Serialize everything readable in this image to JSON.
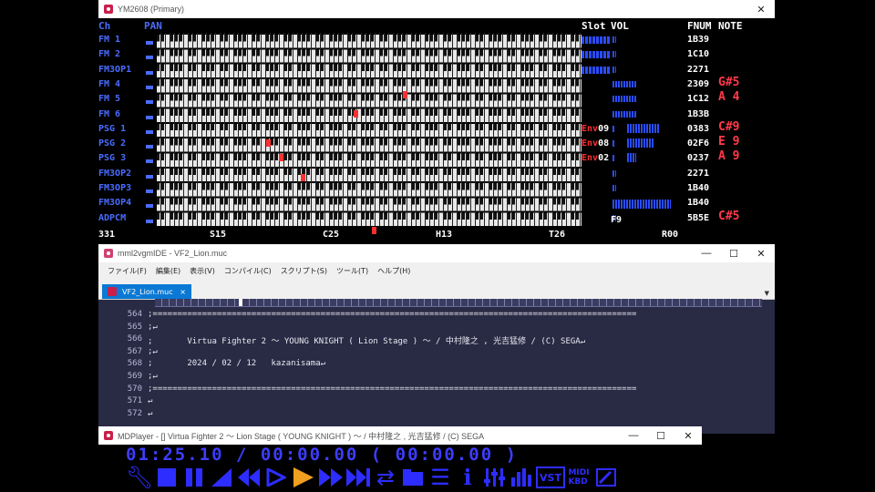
{
  "ym": {
    "title": "YM2608 (Primary)",
    "hdr_ch": "Ch",
    "hdr_pan": "PAN",
    "hdr_slot": "Slot",
    "hdr_vol": "VOL",
    "hdr_fnum": "FNUM",
    "hdr_note": "NOTE",
    "channels": [
      "FM 1",
      "FM 2",
      "FM3OP1",
      "FM 4",
      "FM 5",
      "FM 6",
      "PSG 1",
      "PSG 2",
      "PSG 3",
      "FM3OP2",
      "FM3OP3",
      "FM3OP4",
      "ADPCM"
    ],
    "fnums": [
      "1B39",
      "1C10",
      "2271",
      "2309",
      "1C12",
      "1B3B",
      "0383",
      "02F6",
      "0237",
      "2271",
      "1B40",
      "1B40",
      "5B5E"
    ],
    "notes": [
      {
        "row": 3,
        "text": "G#5"
      },
      {
        "row": 4,
        "text": "A 4"
      },
      {
        "row": 6,
        "text": "C#9"
      },
      {
        "row": 7,
        "text": "E 9"
      },
      {
        "row": 8,
        "text": "A 9"
      },
      {
        "row": 12,
        "text": "C#5"
      }
    ],
    "env": [
      {
        "row": 6,
        "label": "Env",
        "val": "09"
      },
      {
        "row": 7,
        "label": "Env",
        "val": "08"
      },
      {
        "row": 8,
        "label": "Env",
        "val": "02"
      }
    ],
    "adpcm_f": "F9",
    "bottom": {
      "a": "331",
      "s": "S15",
      "c": "C25",
      "h": "H13",
      "t": "T26",
      "r": "R00"
    }
  },
  "ide": {
    "title": "mml2vgmIDE - VF2_Lion.muc",
    "menu": [
      "ファイル(F)",
      "編集(E)",
      "表示(V)",
      "コンパイル(C)",
      "スクリプト(S)",
      "ツール(T)",
      "ヘルプ(H)"
    ],
    "tab_label": "VF2_Lion.muc",
    "tab_close": "×",
    "lines": [
      {
        "n": "564",
        "t": ";=================================================================================================="
      },
      {
        "n": "565",
        "t": ";↵"
      },
      {
        "n": "566",
        "t": ";       Virtua Fighter 2 ～ YOUNG KNIGHT ( Lion Stage ) ～ / 中村隆之 , 光吉猛修 / (C) SEGA↵"
      },
      {
        "n": "567",
        "t": ";↵"
      },
      {
        "n": "568",
        "t": ";       2024 / 02 / 12   kazanisama↵"
      },
      {
        "n": "569",
        "t": ";↵"
      },
      {
        "n": "570",
        "t": ";=================================================================================================="
      },
      {
        "n": "571",
        "t": "↵"
      },
      {
        "n": "572",
        "t": "↵"
      }
    ]
  },
  "mdp": {
    "title": "MDPlayer - [] Virtua Fighter 2 ～ Lion Stage ( YOUNG KNIGHT ) ～ / 中村隆之 , 光吉猛修 / (C) SEGA",
    "timer": "01:25.10 / 00:00.00 ( 00:00.00 )"
  },
  "win": {
    "min": "—",
    "max": "☐",
    "close": "✕"
  }
}
